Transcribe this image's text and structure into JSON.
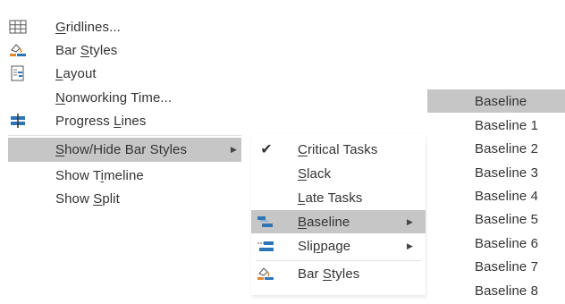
{
  "main_menu": {
    "items": [
      {
        "pre": "",
        "acc": "G",
        "post": "ridlines...",
        "icon": "gridlines-icon"
      },
      {
        "pre": "Bar ",
        "acc": "S",
        "post": "tyles",
        "icon": "bar-styles-icon"
      },
      {
        "pre": "",
        "acc": "L",
        "post": "ayout",
        "icon": "layout-icon"
      },
      {
        "pre": "",
        "acc": "N",
        "post": "onworking Time...",
        "icon": ""
      },
      {
        "pre": "Progress ",
        "acc": "L",
        "post": "ines",
        "icon": "progress-lines-icon"
      },
      {
        "pre": "",
        "acc": "S",
        "post": "how/Hide Bar Styles",
        "icon": "",
        "submenu": true,
        "highlighted": true
      },
      {
        "pre": "Show T",
        "acc": "i",
        "post": "meline",
        "icon": ""
      },
      {
        "pre": "Show ",
        "acc": "S",
        "post": "plit",
        "icon": ""
      }
    ]
  },
  "show_hide_menu": {
    "items": [
      {
        "pre": "",
        "acc": "C",
        "post": "ritical Tasks",
        "icon": "check-icon",
        "checked": true
      },
      {
        "pre": "",
        "acc": "S",
        "post": "lack",
        "icon": ""
      },
      {
        "pre": "",
        "acc": "L",
        "post": "ate Tasks",
        "icon": ""
      },
      {
        "pre": "",
        "acc": "B",
        "post": "aseline",
        "icon": "baseline-icon",
        "submenu": true,
        "highlighted": true
      },
      {
        "pre": "Sli",
        "acc": "p",
        "post": "page",
        "icon": "slippage-icon",
        "submenu": true
      },
      {
        "pre": "Bar ",
        "acc": "S",
        "post": "tyles",
        "icon": "bar-styles-icon"
      }
    ]
  },
  "baseline_menu": {
    "items": [
      "Baseline",
      "Baseline 1",
      "Baseline 2",
      "Baseline 3",
      "Baseline 4",
      "Baseline 5",
      "Baseline 6",
      "Baseline 7",
      "Baseline 8"
    ]
  },
  "submenu_arrow": "▶",
  "checkmark": "✔",
  "colors": {
    "highlight": "#c6c6c6",
    "icon_blue": "#2e75b6",
    "icon_orange": "#e0882a",
    "text": "#333333"
  }
}
